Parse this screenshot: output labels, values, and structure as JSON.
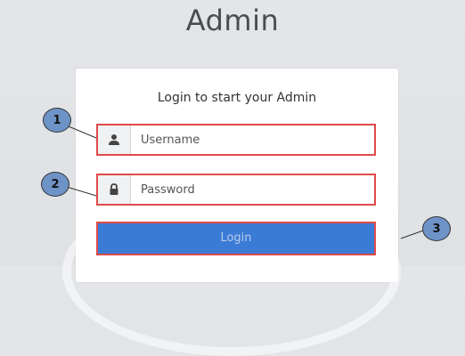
{
  "page": {
    "title": "Admin"
  },
  "login_box": {
    "heading": "Login to start your Admin",
    "username_placeholder": "Username",
    "password_placeholder": "Password",
    "login_label": "Login"
  },
  "callouts": [
    "1",
    "2",
    "3"
  ],
  "colors": {
    "highlight_border": "#e04a4a",
    "button_blue": "#3a7bd5",
    "callout_fill": "#6e93c7"
  },
  "icons": [
    "user-icon",
    "lock-icon"
  ]
}
